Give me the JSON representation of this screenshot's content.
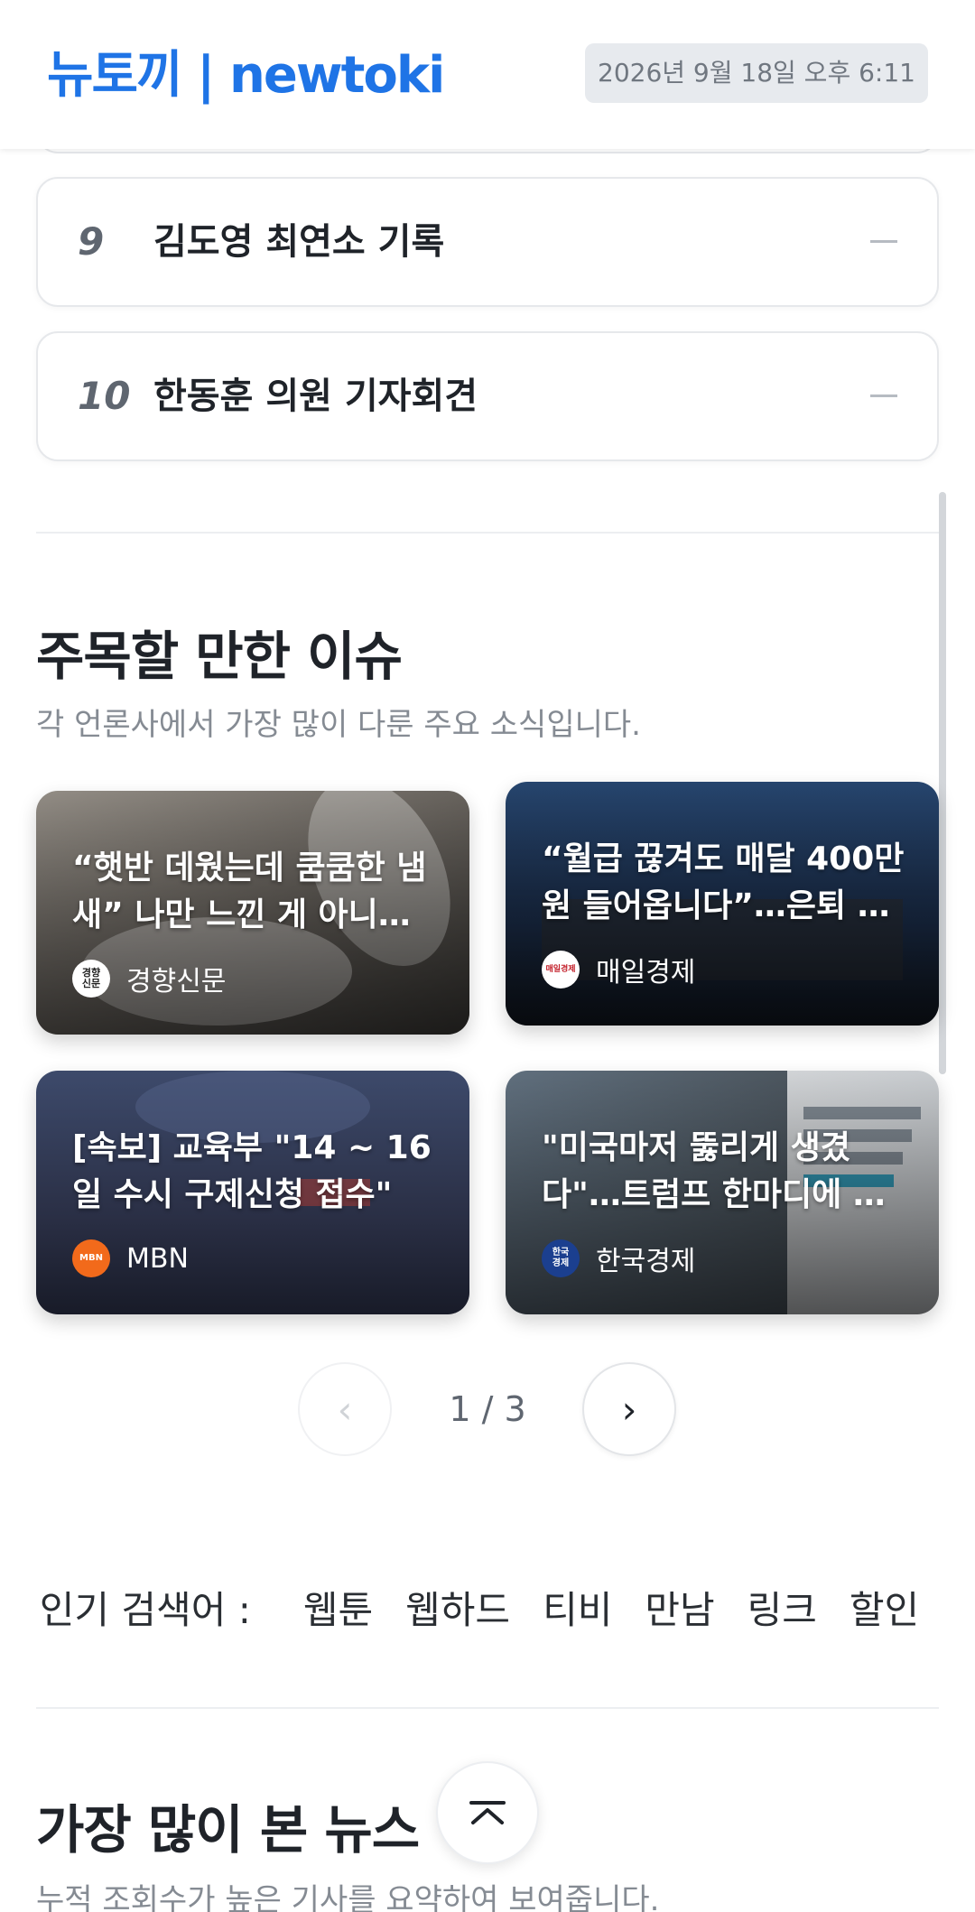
{
  "header": {
    "logo": "뉴토끼 | newtoki",
    "datetime": "2026년 9월 18일 오후 6:11"
  },
  "ranking": [
    {
      "rank": "9",
      "title": "김도영 최연소 기록"
    },
    {
      "rank": "10",
      "title": "한동훈 의원 기자회견"
    }
  ],
  "issues": {
    "title": "주목할 만한 이슈",
    "subtitle": "각 언론사에서 가장 많이 다룬 주요 소식입니다.",
    "cards": [
      {
        "title": "“햇반 데웠는데 쿰쿰한 냄새” 나만 느낀 게 아니…",
        "source": "경향신문",
        "source_logo": "경향신문"
      },
      {
        "title": "“월급 끊겨도 매달 400만원 들어옵니다”…은퇴 …",
        "source": "매일경제",
        "source_logo": "매일경제"
      },
      {
        "title": "[속보] 교육부 \"14 ~ 16일 수시 구제신청 접수\"",
        "source": "MBN",
        "source_logo": "MBN"
      },
      {
        "title": "\"미국마저 뚫리게 생겼다\"…트럼프 한마디에 …",
        "source": "한국경제",
        "source_logo": "한국경제"
      }
    ],
    "pager": {
      "current": 1,
      "total": 3,
      "text": "1 / 3",
      "prev": "‹",
      "next": "›"
    }
  },
  "popular_search": {
    "label": "인기 검색어 :",
    "keywords": [
      "웹툰",
      "웹하드",
      "티비",
      "만남",
      "링크",
      "할인"
    ]
  },
  "most_viewed": {
    "title": "가장 많이 본 뉴스",
    "subtitle": "누적 조회수가 높은 기사를 요약하여 보여줍니다."
  },
  "colors": {
    "brand": "#1f74e6",
    "mbn": "#f26a1b",
    "hankyung": "#1b3f8f"
  },
  "icons": {
    "scroll_top": "chevron-up-icon"
  }
}
